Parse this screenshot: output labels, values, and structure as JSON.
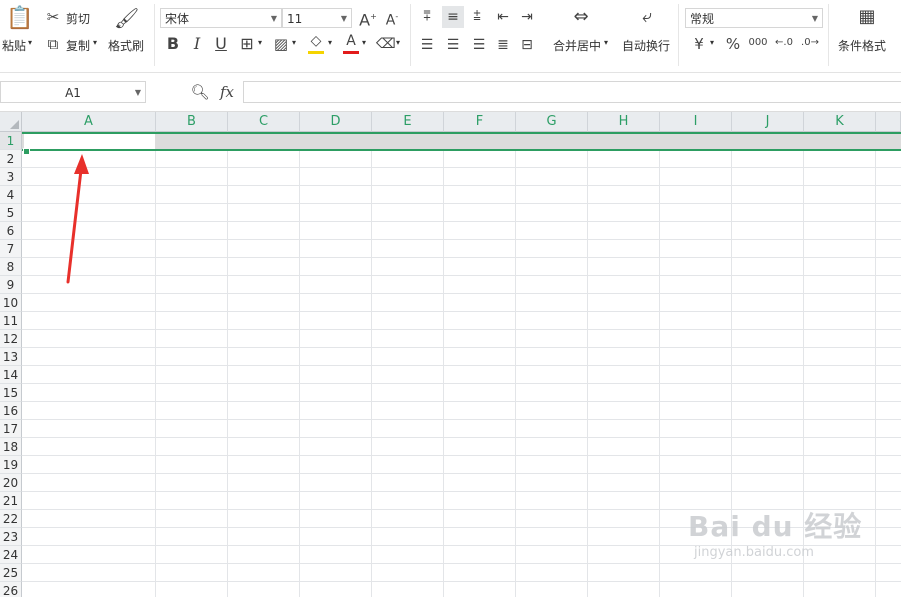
{
  "ribbon": {
    "paste": "粘贴",
    "cut": "剪切",
    "copy": "复制",
    "format_painter": "格式刷",
    "font_name": "宋体",
    "font_size": "11",
    "merge_center": "合并居中",
    "wrap_text": "自动换行",
    "number_format": "常规",
    "conditional_format": "条件格式",
    "bold": "B",
    "italic": "I",
    "underline": "U",
    "percent": "%",
    "currency": "¥"
  },
  "formula_bar": {
    "name_box": "A1",
    "fx": "fx",
    "formula": ""
  },
  "sheet": {
    "columns": [
      "A",
      "B",
      "C",
      "D",
      "E",
      "F",
      "G",
      "H",
      "I",
      "J",
      "K"
    ],
    "rows": [
      "1",
      "2",
      "3",
      "4",
      "5",
      "6",
      "7",
      "8",
      "9",
      "10",
      "11",
      "12",
      "13",
      "14",
      "15",
      "16",
      "17",
      "18",
      "19",
      "20",
      "21",
      "22",
      "23",
      "24",
      "25",
      "26"
    ],
    "selected_cell": "A1",
    "selected_row": "1",
    "accent_color": "#2d9d61"
  },
  "annotation": {
    "arrow_color": "#e8302b"
  },
  "watermark": {
    "line1": "Bai du 经验",
    "line2": "jingyan.baidu.com"
  }
}
